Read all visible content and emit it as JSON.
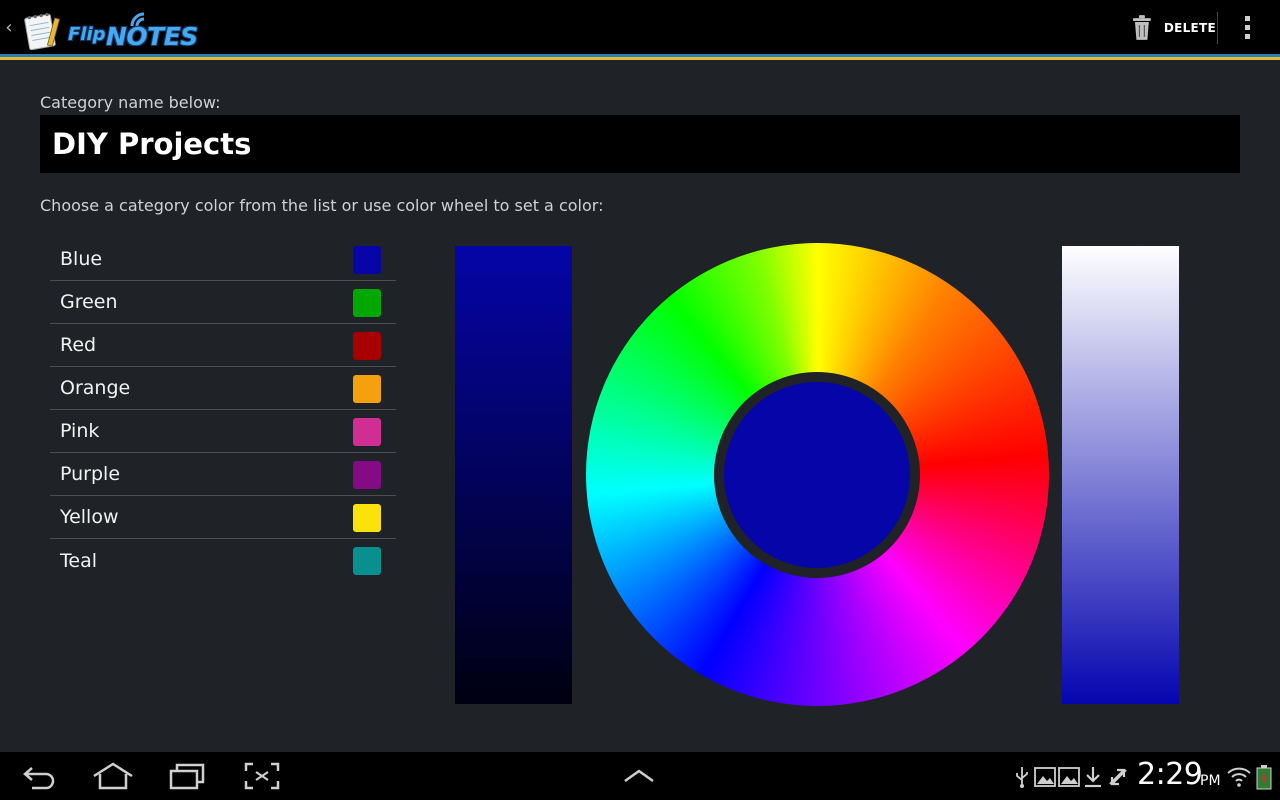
{
  "app": {
    "logo_small": "Flip",
    "logo_main": "NOTES",
    "icons": {
      "up": "chevron-left-icon",
      "logo": "notepad-icon"
    }
  },
  "action_bar": {
    "delete_label": "DELETE",
    "icons": {
      "delete": "trash-icon",
      "overflow": "overflow-menu-icon"
    },
    "colors": {
      "stripe_top": "#2a80b9",
      "stripe_bottom": "#e8b73a"
    }
  },
  "form": {
    "name_label": "Category name below:",
    "name_value": "DIY Projects",
    "color_prompt": "Choose a category color from the list or use color wheel to set a color:"
  },
  "colors": [
    {
      "name": "Blue",
      "hex": "#0505a8"
    },
    {
      "name": "Green",
      "hex": "#00a800"
    },
    {
      "name": "Red",
      "hex": "#a80000"
    },
    {
      "name": "Orange",
      "hex": "#f5a00f"
    },
    {
      "name": "Pink",
      "hex": "#d12e94"
    },
    {
      "name": "Purple",
      "hex": "#850a85"
    },
    {
      "name": "Yellow",
      "hex": "#fbe20a"
    },
    {
      "name": "Teal",
      "hex": "#088f8f"
    }
  ],
  "picker": {
    "selected_color": "#0505a8",
    "parts": [
      "saturation-value-bar",
      "hue-wheel",
      "opacity-bar"
    ]
  },
  "system_bar": {
    "time": "2:29",
    "ampm": "PM",
    "icons": [
      "back-icon",
      "home-icon",
      "recent-apps-icon",
      "screenshot-icon",
      "expand-up-icon",
      "usb-icon",
      "gallery-icon",
      "gallery-icon",
      "download-icon",
      "sync-icon",
      "wifi-icon",
      "battery-icon"
    ]
  }
}
